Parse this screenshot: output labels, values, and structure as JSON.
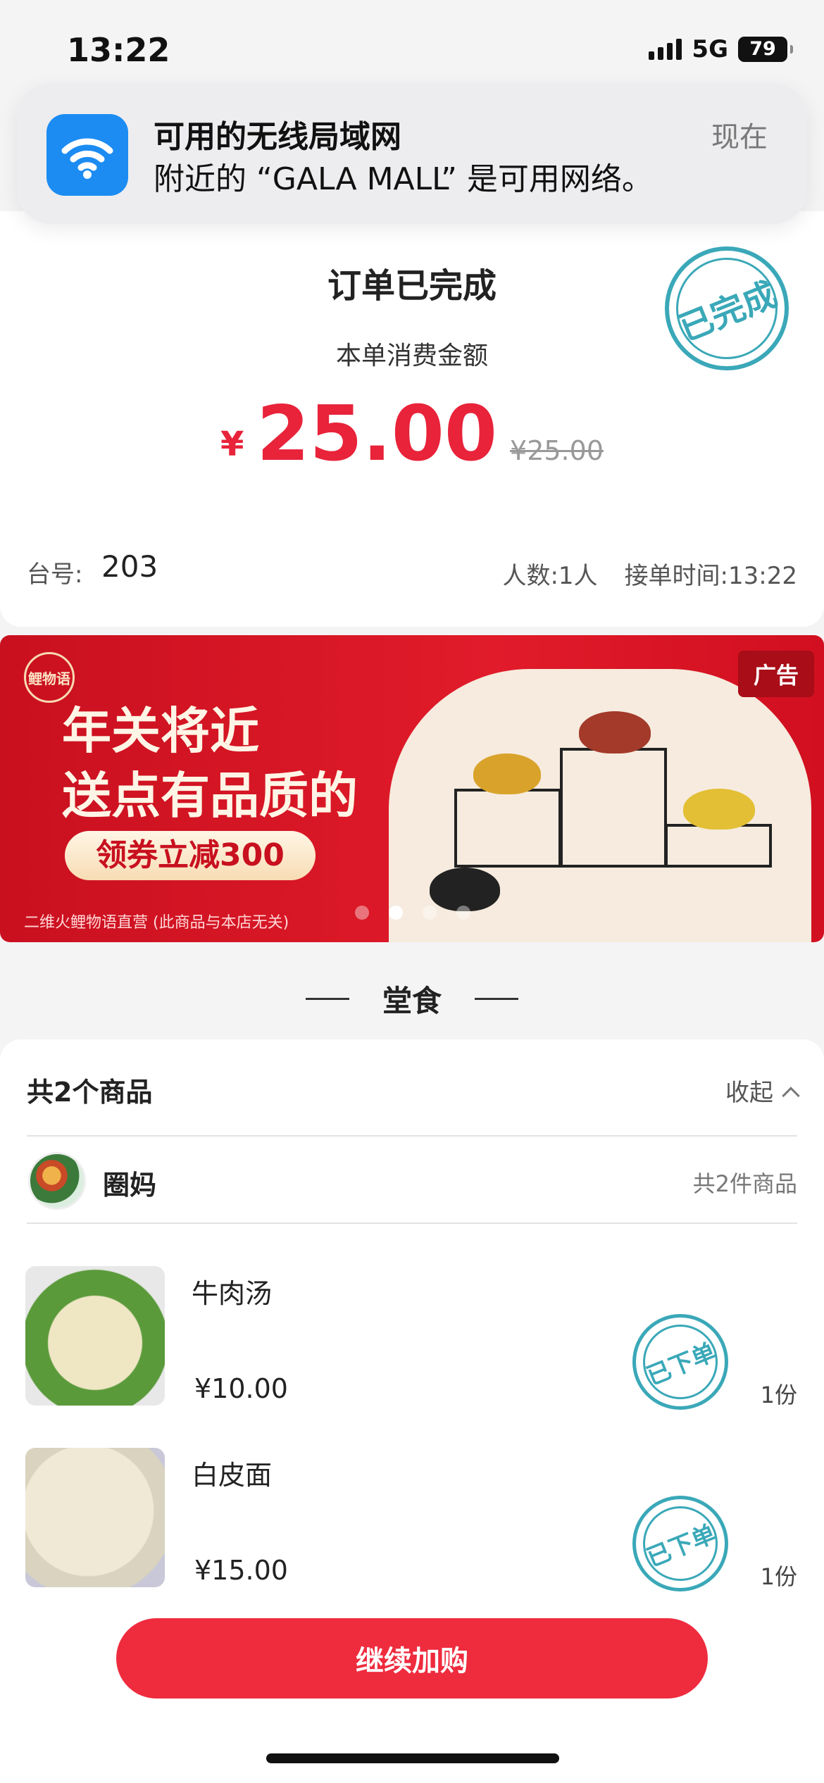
{
  "status_bar": {
    "time": "13:22",
    "network": "5G",
    "battery": "79"
  },
  "notification": {
    "title": "可用的无线局域网",
    "body": "附近的 “GALA MALL” 是可用网络。",
    "time": "现在",
    "icon": "wifi-icon"
  },
  "order": {
    "status_title": "订单已完成",
    "amount_label": "本单消费金额",
    "currency_symbol": "¥",
    "amount": "25.00",
    "original_amount": "¥25.00",
    "table_label": "台号:",
    "table_number": "203",
    "people": "人数:1人",
    "order_time": "接单时间:13:22",
    "stamp_text": "已完成"
  },
  "ad_banner": {
    "brand": "鲤物语",
    "headline_line1": "年关将近",
    "headline_line2": "送点有品质的",
    "coupon": "领券立减300",
    "footer": "二维火鲤物语直营 (此商品与本店无关)",
    "ad_tag": "广告",
    "active_dot": 1,
    "dot_count": 4
  },
  "dine_in": {
    "section_title": "堂食",
    "goods_count": "共2个商品",
    "collapse_label": "收起",
    "store_name": "圈妈",
    "store_count": "共2件商品",
    "items": [
      {
        "name": "牛肉汤",
        "price": "¥10.00",
        "qty": "1份",
        "stamp": "已下单"
      },
      {
        "name": "白皮面",
        "price": "¥15.00",
        "qty": "1份",
        "stamp": "已下单"
      }
    ]
  },
  "actions": {
    "continue_label": "继续加购"
  },
  "colors": {
    "accent_red": "#e8233a",
    "stamp_teal": "#3aa8b8",
    "button_red": "#ef2b3e"
  }
}
